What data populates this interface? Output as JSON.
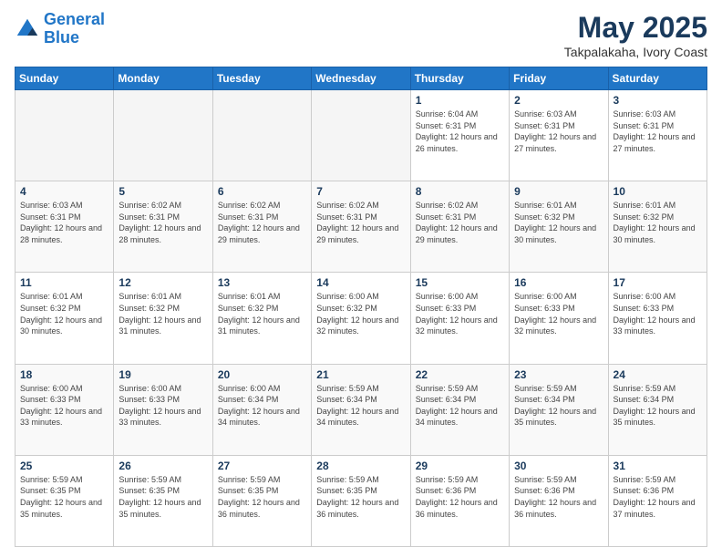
{
  "header": {
    "logo_line1": "General",
    "logo_line2": "Blue",
    "title": "May 2025",
    "subtitle": "Takpalakaha, Ivory Coast"
  },
  "days_of_week": [
    "Sunday",
    "Monday",
    "Tuesday",
    "Wednesday",
    "Thursday",
    "Friday",
    "Saturday"
  ],
  "weeks": [
    [
      {
        "num": "",
        "empty": true
      },
      {
        "num": "",
        "empty": true
      },
      {
        "num": "",
        "empty": true
      },
      {
        "num": "",
        "empty": true
      },
      {
        "num": "1",
        "rise": "6:04 AM",
        "set": "6:31 PM",
        "hours": "12 hours and 26 minutes."
      },
      {
        "num": "2",
        "rise": "6:03 AM",
        "set": "6:31 PM",
        "hours": "12 hours and 27 minutes."
      },
      {
        "num": "3",
        "rise": "6:03 AM",
        "set": "6:31 PM",
        "hours": "12 hours and 27 minutes."
      }
    ],
    [
      {
        "num": "4",
        "rise": "6:03 AM",
        "set": "6:31 PM",
        "hours": "12 hours and 28 minutes."
      },
      {
        "num": "5",
        "rise": "6:02 AM",
        "set": "6:31 PM",
        "hours": "12 hours and 28 minutes."
      },
      {
        "num": "6",
        "rise": "6:02 AM",
        "set": "6:31 PM",
        "hours": "12 hours and 29 minutes."
      },
      {
        "num": "7",
        "rise": "6:02 AM",
        "set": "6:31 PM",
        "hours": "12 hours and 29 minutes."
      },
      {
        "num": "8",
        "rise": "6:02 AM",
        "set": "6:31 PM",
        "hours": "12 hours and 29 minutes."
      },
      {
        "num": "9",
        "rise": "6:01 AM",
        "set": "6:32 PM",
        "hours": "12 hours and 30 minutes."
      },
      {
        "num": "10",
        "rise": "6:01 AM",
        "set": "6:32 PM",
        "hours": "12 hours and 30 minutes."
      }
    ],
    [
      {
        "num": "11",
        "rise": "6:01 AM",
        "set": "6:32 PM",
        "hours": "12 hours and 30 minutes."
      },
      {
        "num": "12",
        "rise": "6:01 AM",
        "set": "6:32 PM",
        "hours": "12 hours and 31 minutes."
      },
      {
        "num": "13",
        "rise": "6:01 AM",
        "set": "6:32 PM",
        "hours": "12 hours and 31 minutes."
      },
      {
        "num": "14",
        "rise": "6:00 AM",
        "set": "6:32 PM",
        "hours": "12 hours and 32 minutes."
      },
      {
        "num": "15",
        "rise": "6:00 AM",
        "set": "6:33 PM",
        "hours": "12 hours and 32 minutes."
      },
      {
        "num": "16",
        "rise": "6:00 AM",
        "set": "6:33 PM",
        "hours": "12 hours and 32 minutes."
      },
      {
        "num": "17",
        "rise": "6:00 AM",
        "set": "6:33 PM",
        "hours": "12 hours and 33 minutes."
      }
    ],
    [
      {
        "num": "18",
        "rise": "6:00 AM",
        "set": "6:33 PM",
        "hours": "12 hours and 33 minutes."
      },
      {
        "num": "19",
        "rise": "6:00 AM",
        "set": "6:33 PM",
        "hours": "12 hours and 33 minutes."
      },
      {
        "num": "20",
        "rise": "6:00 AM",
        "set": "6:34 PM",
        "hours": "12 hours and 34 minutes."
      },
      {
        "num": "21",
        "rise": "5:59 AM",
        "set": "6:34 PM",
        "hours": "12 hours and 34 minutes."
      },
      {
        "num": "22",
        "rise": "5:59 AM",
        "set": "6:34 PM",
        "hours": "12 hours and 34 minutes."
      },
      {
        "num": "23",
        "rise": "5:59 AM",
        "set": "6:34 PM",
        "hours": "12 hours and 35 minutes."
      },
      {
        "num": "24",
        "rise": "5:59 AM",
        "set": "6:34 PM",
        "hours": "12 hours and 35 minutes."
      }
    ],
    [
      {
        "num": "25",
        "rise": "5:59 AM",
        "set": "6:35 PM",
        "hours": "12 hours and 35 minutes."
      },
      {
        "num": "26",
        "rise": "5:59 AM",
        "set": "6:35 PM",
        "hours": "12 hours and 35 minutes."
      },
      {
        "num": "27",
        "rise": "5:59 AM",
        "set": "6:35 PM",
        "hours": "12 hours and 36 minutes."
      },
      {
        "num": "28",
        "rise": "5:59 AM",
        "set": "6:35 PM",
        "hours": "12 hours and 36 minutes."
      },
      {
        "num": "29",
        "rise": "5:59 AM",
        "set": "6:36 PM",
        "hours": "12 hours and 36 minutes."
      },
      {
        "num": "30",
        "rise": "5:59 AM",
        "set": "6:36 PM",
        "hours": "12 hours and 36 minutes."
      },
      {
        "num": "31",
        "rise": "5:59 AM",
        "set": "6:36 PM",
        "hours": "12 hours and 37 minutes."
      }
    ]
  ]
}
